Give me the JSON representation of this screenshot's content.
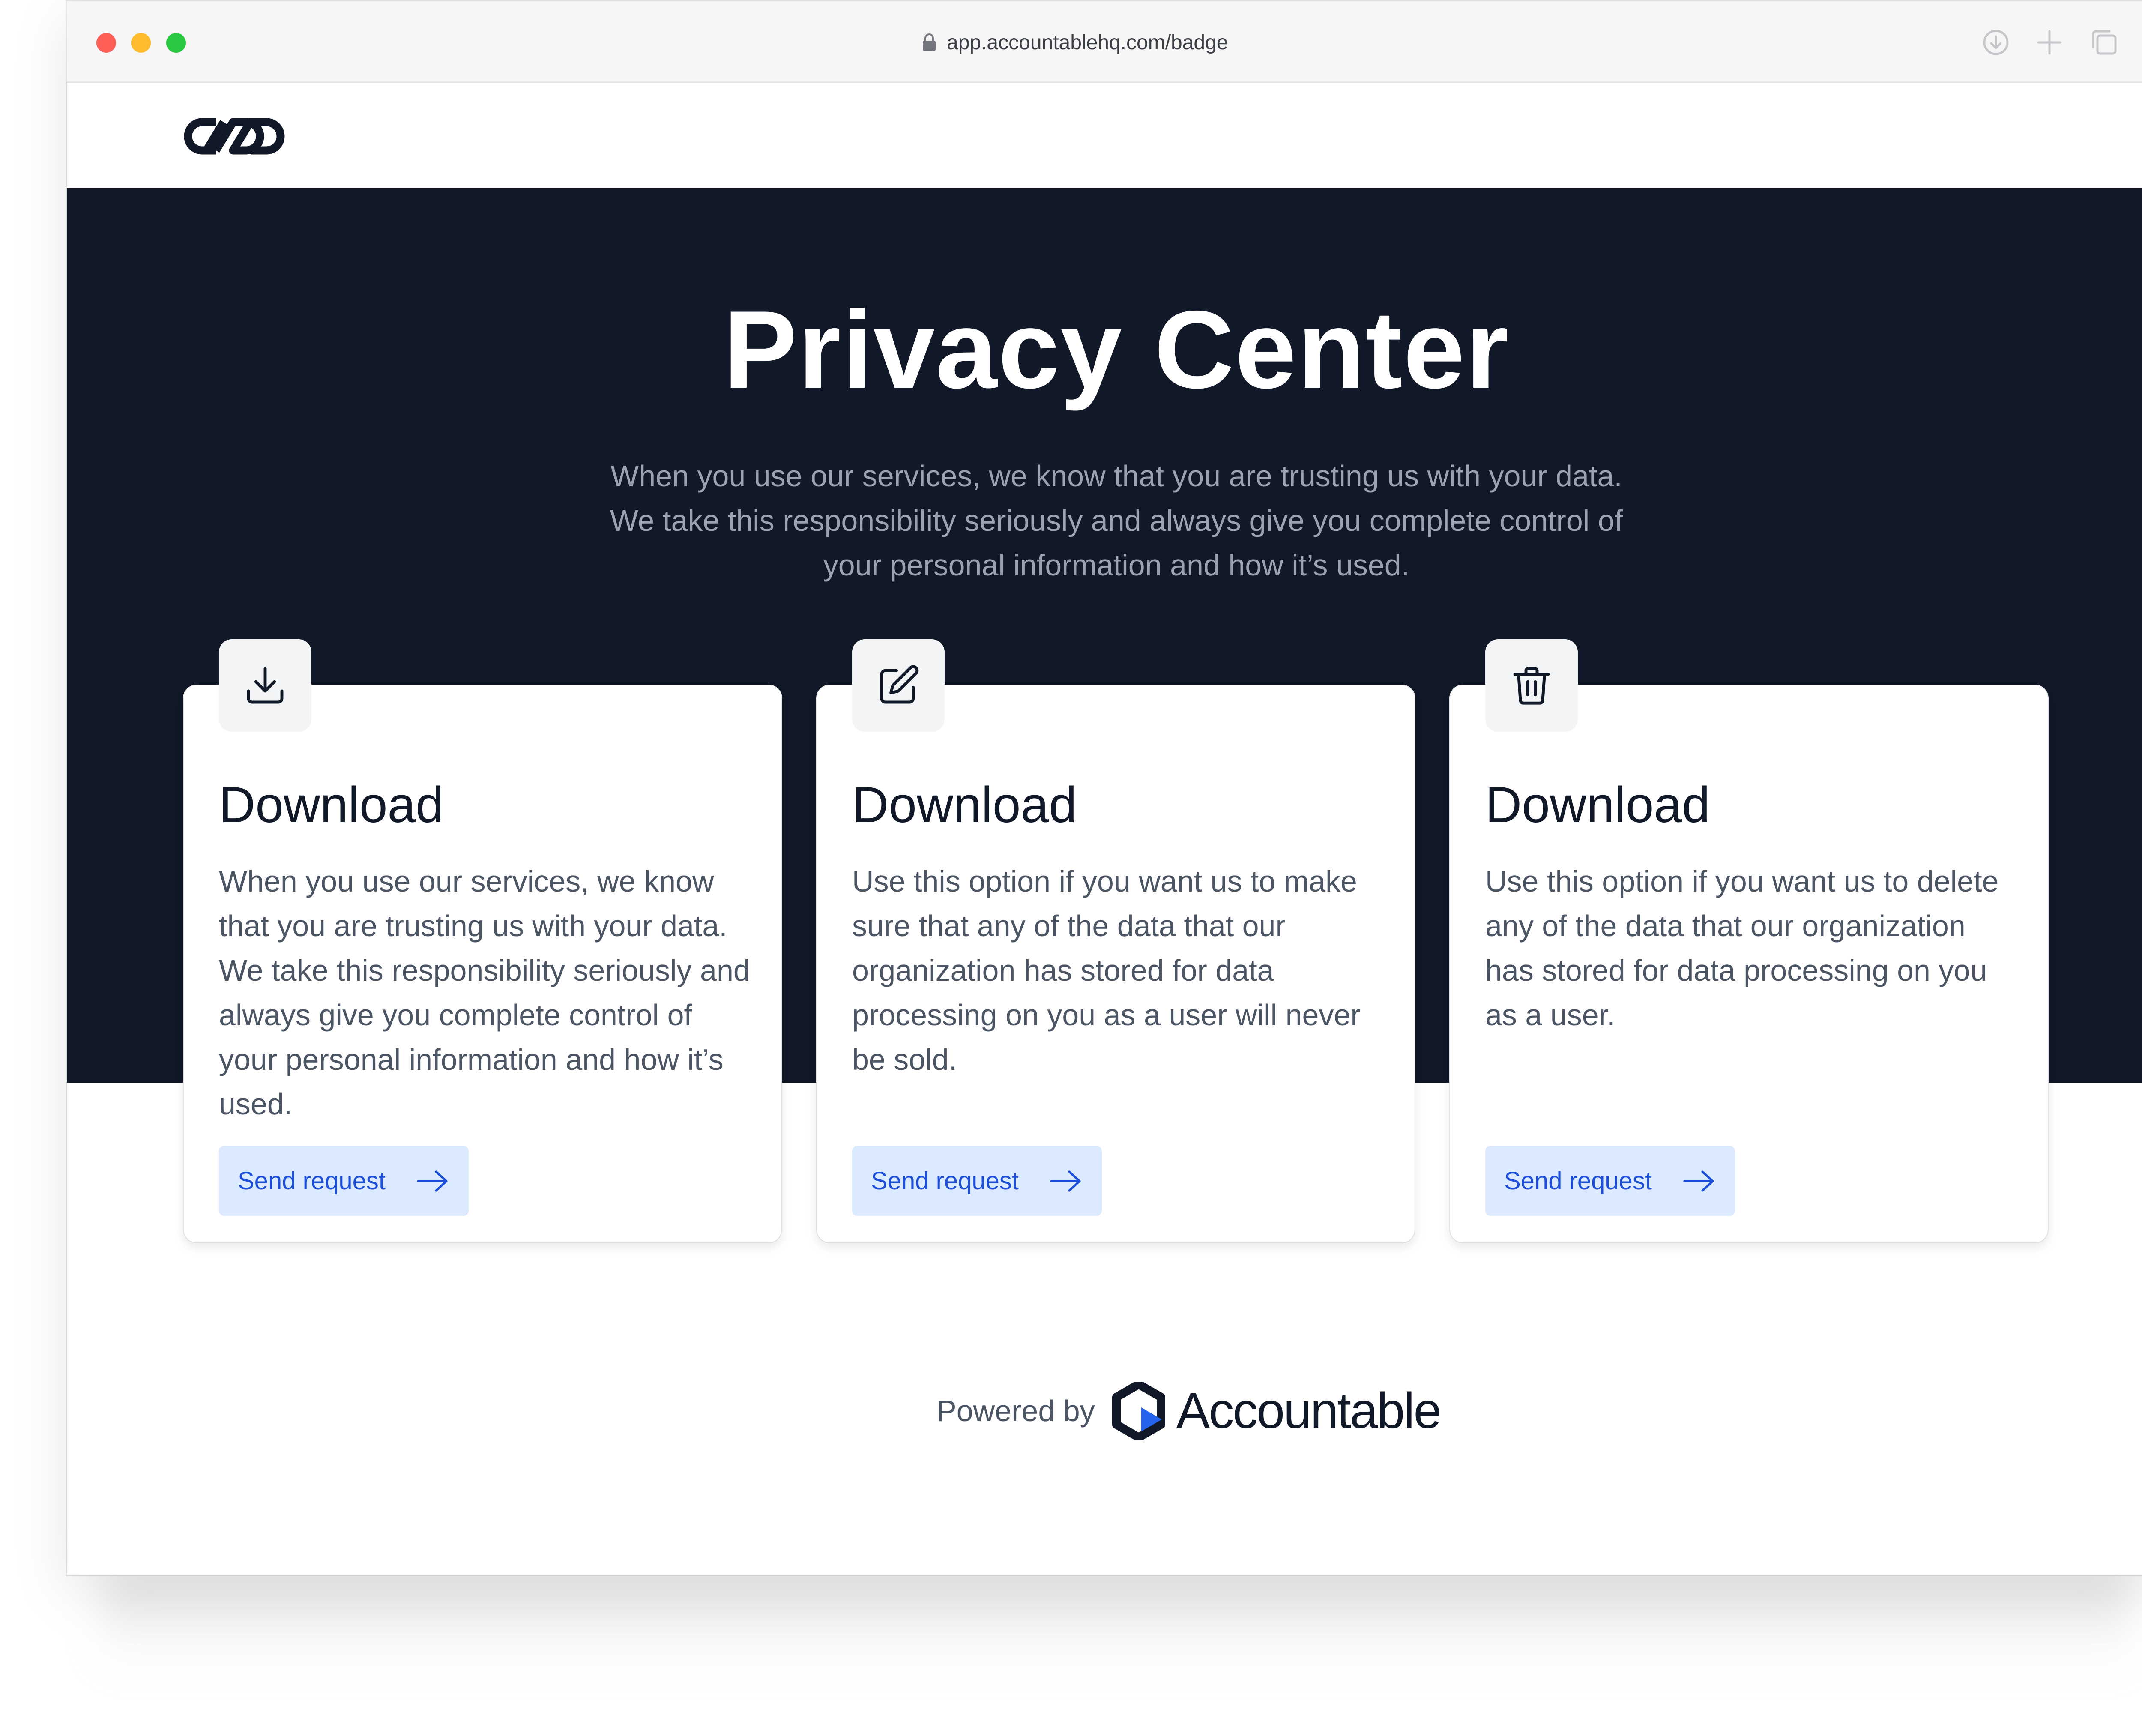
{
  "browser": {
    "url": "app.accountablehq.com/badge",
    "icons": [
      "lock-icon",
      "download-circle-icon",
      "plus-icon",
      "tabs-icon"
    ]
  },
  "hero": {
    "title": "Privacy Center",
    "subtitle_lines": [
      "When you use our services, we know that you are trusting us with your data.",
      "We take this responsibility seriously and always give you complete control of",
      "your personal information and how it’s used."
    ]
  },
  "cards": [
    {
      "icon": "download-tray-icon",
      "title": "Download",
      "text_lines": [
        "When you use our services, we know",
        "that you are trusting us with your data.",
        "We take this responsibility seriously and",
        "always give you complete control of",
        "your personal information and how it’s",
        "used."
      ],
      "button_label": "Send request"
    },
    {
      "icon": "edit-pencil-icon",
      "title": "Download",
      "text_lines": [
        "Use this option if you want us to make",
        "sure that any of the data that our",
        "organization has stored for data",
        "processing on you as a user will never",
        "be sold."
      ],
      "button_label": "Send request"
    },
    {
      "icon": "trash-icon",
      "title": "Download",
      "text_lines": [
        "Use this option if you want us to delete",
        "any of the data that our organization",
        "has stored for data processing on you",
        "as a user."
      ],
      "button_label": "Send request"
    }
  ],
  "footer": {
    "powered_by": "Powered by",
    "brand": "Accountable"
  },
  "colors": {
    "hero_bg": "#111827",
    "button_bg": "#dbeafe",
    "button_text": "#1d4ed8",
    "brand_accent": "#2563eb"
  }
}
